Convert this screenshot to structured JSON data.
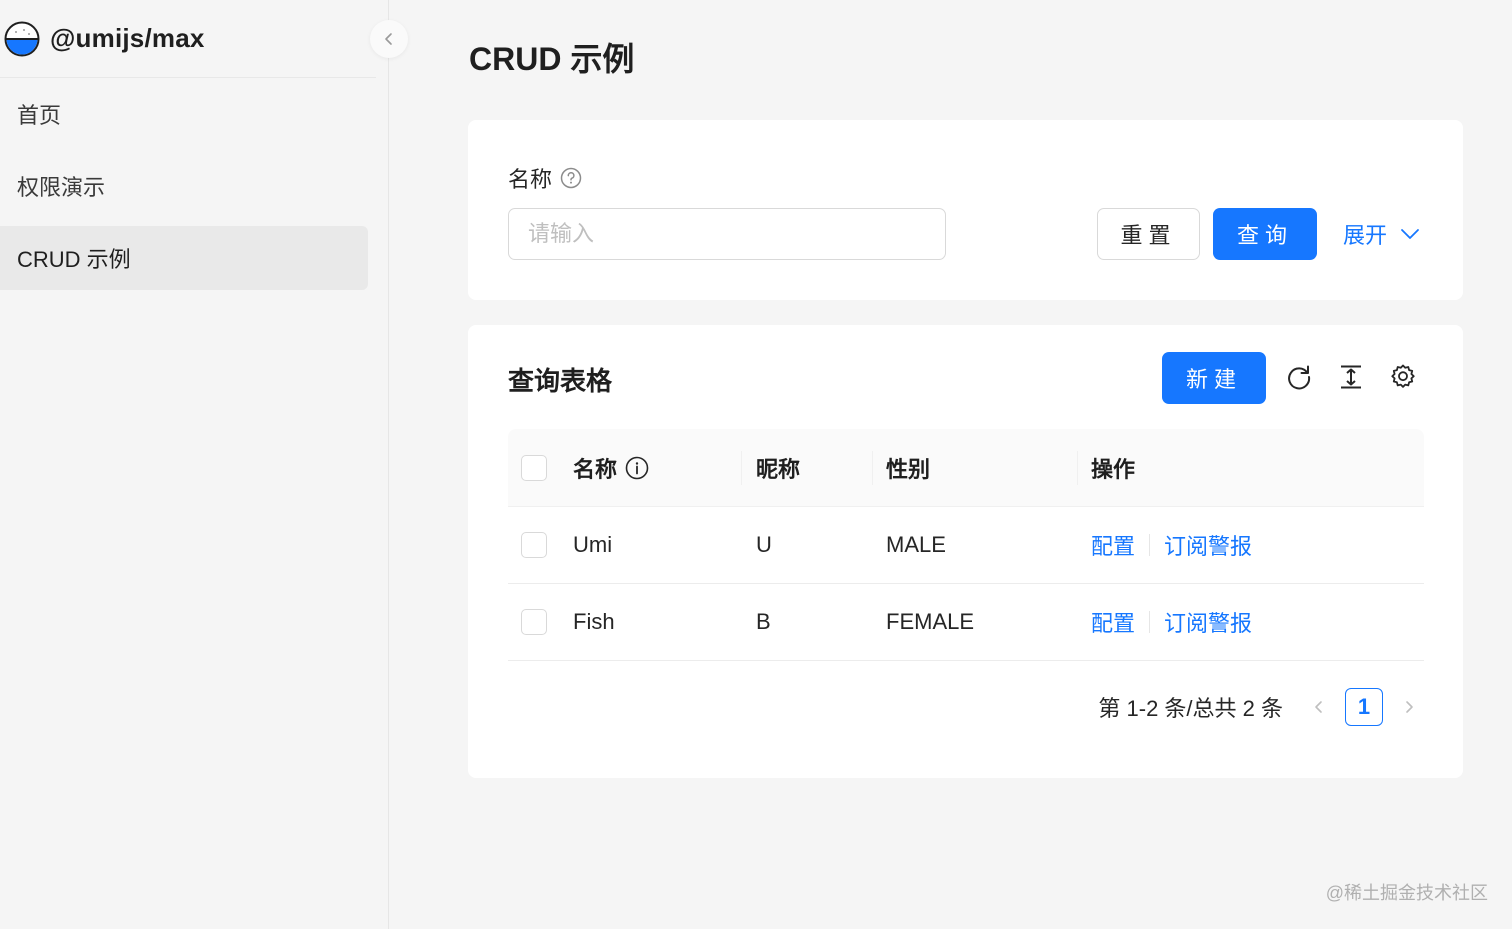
{
  "app": {
    "brand_title": "@umijs/max",
    "logo_icon": "umi-logo-icon"
  },
  "sidebar": {
    "items": [
      {
        "label": "首页",
        "active": false
      },
      {
        "label": "权限演示",
        "active": false
      },
      {
        "label": "CRUD 示例",
        "active": true
      }
    ],
    "collapse_icon": "chevron-left-icon"
  },
  "page": {
    "title": "CRUD 示例"
  },
  "search": {
    "field_label": "名称",
    "input_placeholder": "请输入",
    "input_value": "",
    "reset_label": "重置",
    "query_label": "查询",
    "expand_label": "展开"
  },
  "table": {
    "title": "查询表格",
    "new_label": "新建",
    "toolbar_icons": [
      "reload-icon",
      "column-height-icon",
      "setting-icon"
    ],
    "columns": [
      "名称",
      "昵称",
      "性别",
      "操作"
    ],
    "rows": [
      {
        "name": "Umi",
        "nickname": "U",
        "gender": "MALE",
        "ops": [
          "配置",
          "订阅警报"
        ]
      },
      {
        "name": "Fish",
        "nickname": "B",
        "gender": "FEMALE",
        "ops": [
          "配置",
          "订阅警报"
        ]
      }
    ]
  },
  "pagination": {
    "total_text": "第 1-2 条/总共 2 条",
    "current_page": "1"
  },
  "watermark": "@稀土掘金技术社区",
  "colors": {
    "primary": "#1677ff",
    "background": "#f5f5f5",
    "card": "#ffffff"
  }
}
